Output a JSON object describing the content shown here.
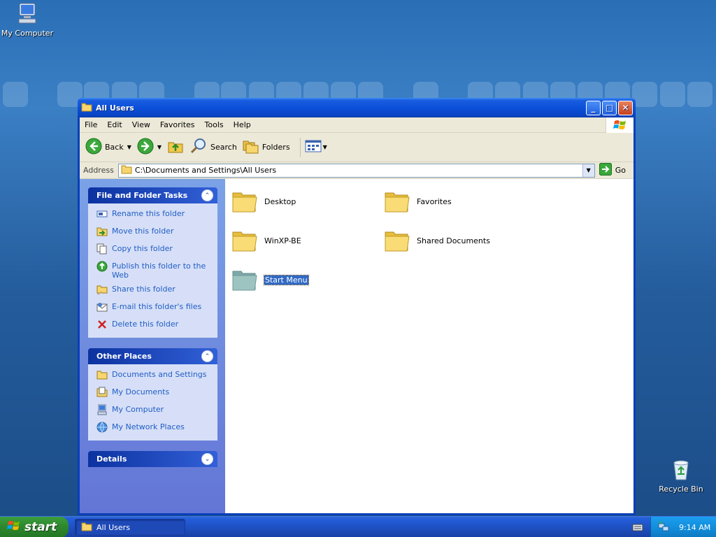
{
  "desktop": {
    "icons": [
      {
        "label": "My Computer",
        "icon": "my-computer-icon"
      },
      {
        "label": "Recycle Bin",
        "icon": "recycle-bin-icon"
      }
    ]
  },
  "window": {
    "title": "All Users",
    "menu": [
      "File",
      "Edit",
      "View",
      "Favorites",
      "Tools",
      "Help"
    ],
    "toolbar": {
      "back": "Back",
      "search": "Search",
      "folders": "Folders"
    },
    "address": {
      "label": "Address",
      "value": "C:\\Documents and Settings\\All Users",
      "go": "Go"
    },
    "task_pane": {
      "file_folder_tasks": {
        "title": "File and Folder Tasks",
        "items": [
          "Rename this folder",
          "Move this folder",
          "Copy this folder",
          "Publish this folder to the Web",
          "Share this folder",
          "E-mail this folder's files",
          "Delete this folder"
        ]
      },
      "other_places": {
        "title": "Other Places",
        "items": [
          "Documents and Settings",
          "My Documents",
          "My Computer",
          "My Network Places"
        ]
      },
      "details": {
        "title": "Details"
      }
    },
    "files": [
      {
        "name": "Desktop",
        "selected": false
      },
      {
        "name": "Favorites",
        "selected": false
      },
      {
        "name": "WinXP-BE",
        "selected": false
      },
      {
        "name": "Shared Documents",
        "selected": false
      },
      {
        "name": "Start Menu",
        "selected": true
      }
    ]
  },
  "taskbar": {
    "start": "start",
    "open_window": "All Users",
    "clock": "9:14 AM"
  },
  "colors": {
    "titlebar": "#0b50d9",
    "taskpane": "#6f8ee0",
    "selection": "#316ac5",
    "start": "#2f8a2f"
  }
}
